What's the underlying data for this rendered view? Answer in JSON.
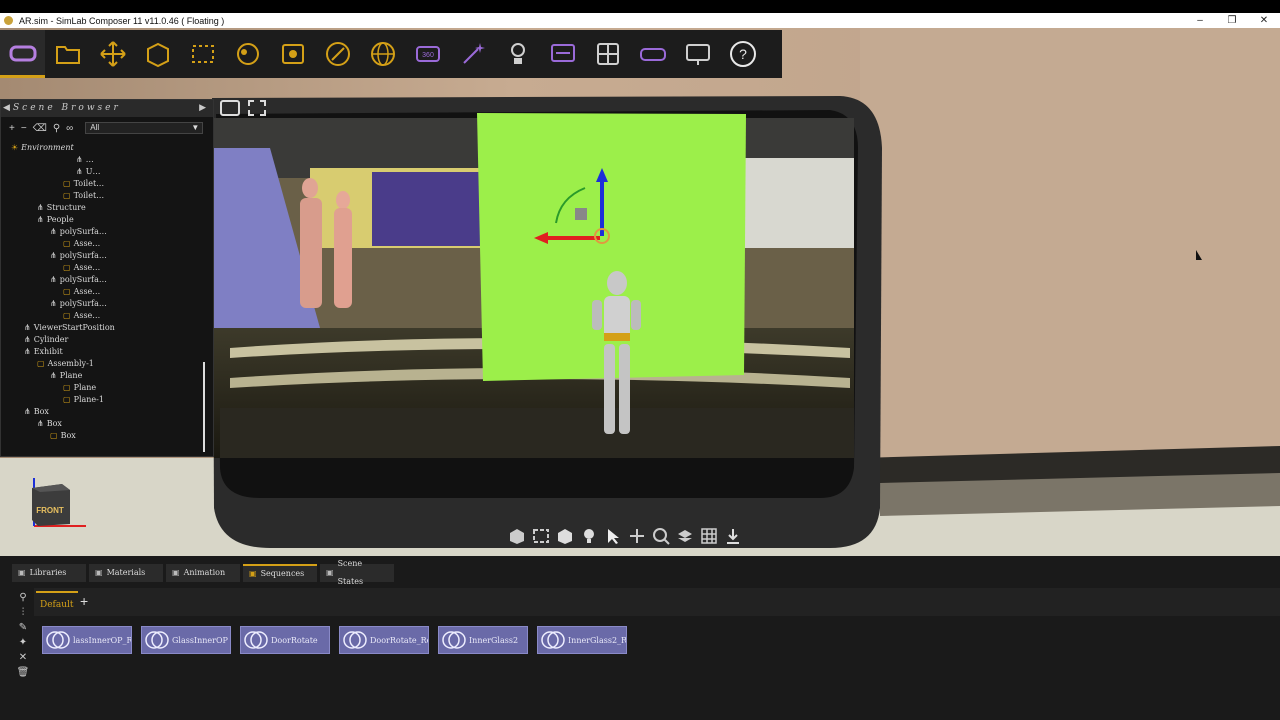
{
  "window": {
    "title": "AR.sim - SimLab Composer 11 v11.0.46 ( Floating )",
    "controls": [
      "minimize-icon",
      "restore-icon",
      "close-icon"
    ]
  },
  "toolbar": {
    "icons": [
      "vr-headset-icon",
      "open-folder-icon",
      "move-icon",
      "edit-3d-icon",
      "selection-box-icon",
      "materials-icon",
      "camera-frame-icon",
      "pen-icon",
      "globe-icon",
      "360-icon",
      "magic-wand-icon",
      "light-icon",
      "presentation-icon",
      "layout-grid-icon",
      "vr-glasses-icon",
      "screen-icon",
      "help-icon"
    ],
    "label_360": "360"
  },
  "scene_browser": {
    "title": "Scene Browser",
    "filter": "All",
    "tree": [
      {
        "label": "Environment",
        "depth": 0
      },
      {
        "label": "…",
        "depth": 5
      },
      {
        "label": "U…",
        "depth": 5
      },
      {
        "label": "Toilet…",
        "depth": 4
      },
      {
        "label": "Toilet…",
        "depth": 4
      },
      {
        "label": "Structure",
        "depth": 2
      },
      {
        "label": "People",
        "depth": 2
      },
      {
        "label": "polySurfa…",
        "depth": 3
      },
      {
        "label": "Asse…",
        "depth": 4
      },
      {
        "label": "polySurfa…",
        "depth": 3
      },
      {
        "label": "Asse…",
        "depth": 4
      },
      {
        "label": "polySurfa…",
        "depth": 3
      },
      {
        "label": "Asse…",
        "depth": 4
      },
      {
        "label": "polySurfa…",
        "depth": 3
      },
      {
        "label": "Asse…",
        "depth": 4
      },
      {
        "label": "ViewerStartPosition",
        "depth": 1
      },
      {
        "label": "Cylinder",
        "depth": 1
      },
      {
        "label": "Exhibit",
        "depth": 1
      },
      {
        "label": "Assembly-1",
        "depth": 2
      },
      {
        "label": "Plane",
        "depth": 3
      },
      {
        "label": "Plane",
        "depth": 4
      },
      {
        "label": "Plane-1",
        "depth": 4
      },
      {
        "label": "Box",
        "depth": 1
      },
      {
        "label": "Box",
        "depth": 2
      },
      {
        "label": "Box",
        "depth": 3
      }
    ]
  },
  "viewport": {
    "nav_cube_label": "FRONT",
    "bottom_icons": [
      "view-cube-icon",
      "fit-icon",
      "box-icon",
      "light-bulb-icon",
      "select-arrow-icon",
      "transform-icon",
      "zoom-icon",
      "layers-icon",
      "grid-icon",
      "download-icon"
    ],
    "colors": {
      "green_screen": "#9cef4a",
      "accent": "#d4a017"
    }
  },
  "bottom_panel": {
    "tabs": [
      {
        "label": "Libraries",
        "icon": "library-icon"
      },
      {
        "label": "Materials",
        "icon": "materials-icon"
      },
      {
        "label": "Animation",
        "icon": "animation-icon"
      },
      {
        "label": "Sequences",
        "icon": "sequences-icon",
        "active": true
      },
      {
        "label": "Scene States",
        "icon": "scene-states-icon"
      }
    ],
    "sequence_tab": "Default",
    "add_label": "+",
    "sequences": [
      "lassInnerOP_R…",
      "GlassInnerOP",
      "DoorRotate",
      "DoorRotate_Rev…",
      "InnerGlass2",
      "InnerGlass2_Rev…"
    ]
  }
}
